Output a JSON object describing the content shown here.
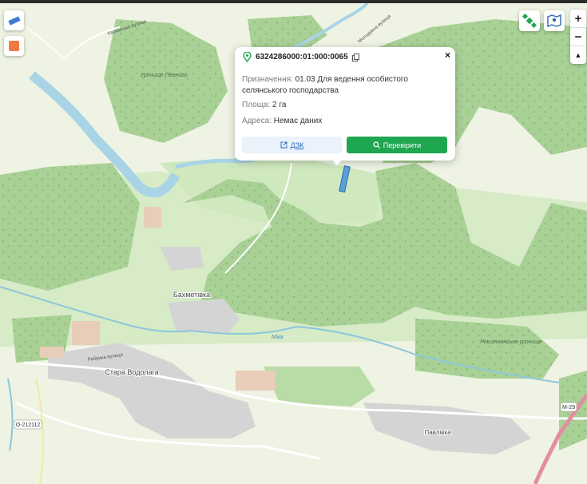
{
  "map": {
    "place_labels": [
      {
        "text": "Бахметівка",
        "name": "place-bakhmetivka"
      },
      {
        "text": "Стара Водолага",
        "name": "place-stara-vodolaha"
      },
      {
        "text": "Павлівка",
        "name": "place-pavlivka"
      },
      {
        "text": "Урочище Певного",
        "name": "place-urochyshche-pevnoho"
      },
      {
        "text": "Рокитнянське урочище",
        "name": "place-rokytnianske"
      },
      {
        "text": "Ребрика вулиця",
        "name": "street-rebryka"
      },
      {
        "text": "Харківська вулиця",
        "name": "street-kharkivska"
      },
      {
        "text": "Молодіжна вулиця",
        "name": "street-molodizhna"
      },
      {
        "text": "Мжа",
        "name": "river-mzha"
      }
    ],
    "road_badges": {
      "o212112": "О-212112",
      "m29": "М-29"
    }
  },
  "controls": {
    "zoom_in": "+",
    "zoom_out": "−",
    "north": "▲",
    "colors": {
      "layer_swatch": "#f07a3f",
      "accent_green": "#1fa650"
    }
  },
  "popup": {
    "cadastral_number": "6324286000:01:000:0065",
    "close_label": "×",
    "purpose_label": "Призначення:",
    "purpose_value": "01.03 Для ведення особистого селянського господарства",
    "area_label": "Площа:",
    "area_value": "2 га",
    "address_label": "Адреса:",
    "address_value": "Немає даних",
    "dzk_button": "ДЗК",
    "check_button": "Перевірити"
  }
}
